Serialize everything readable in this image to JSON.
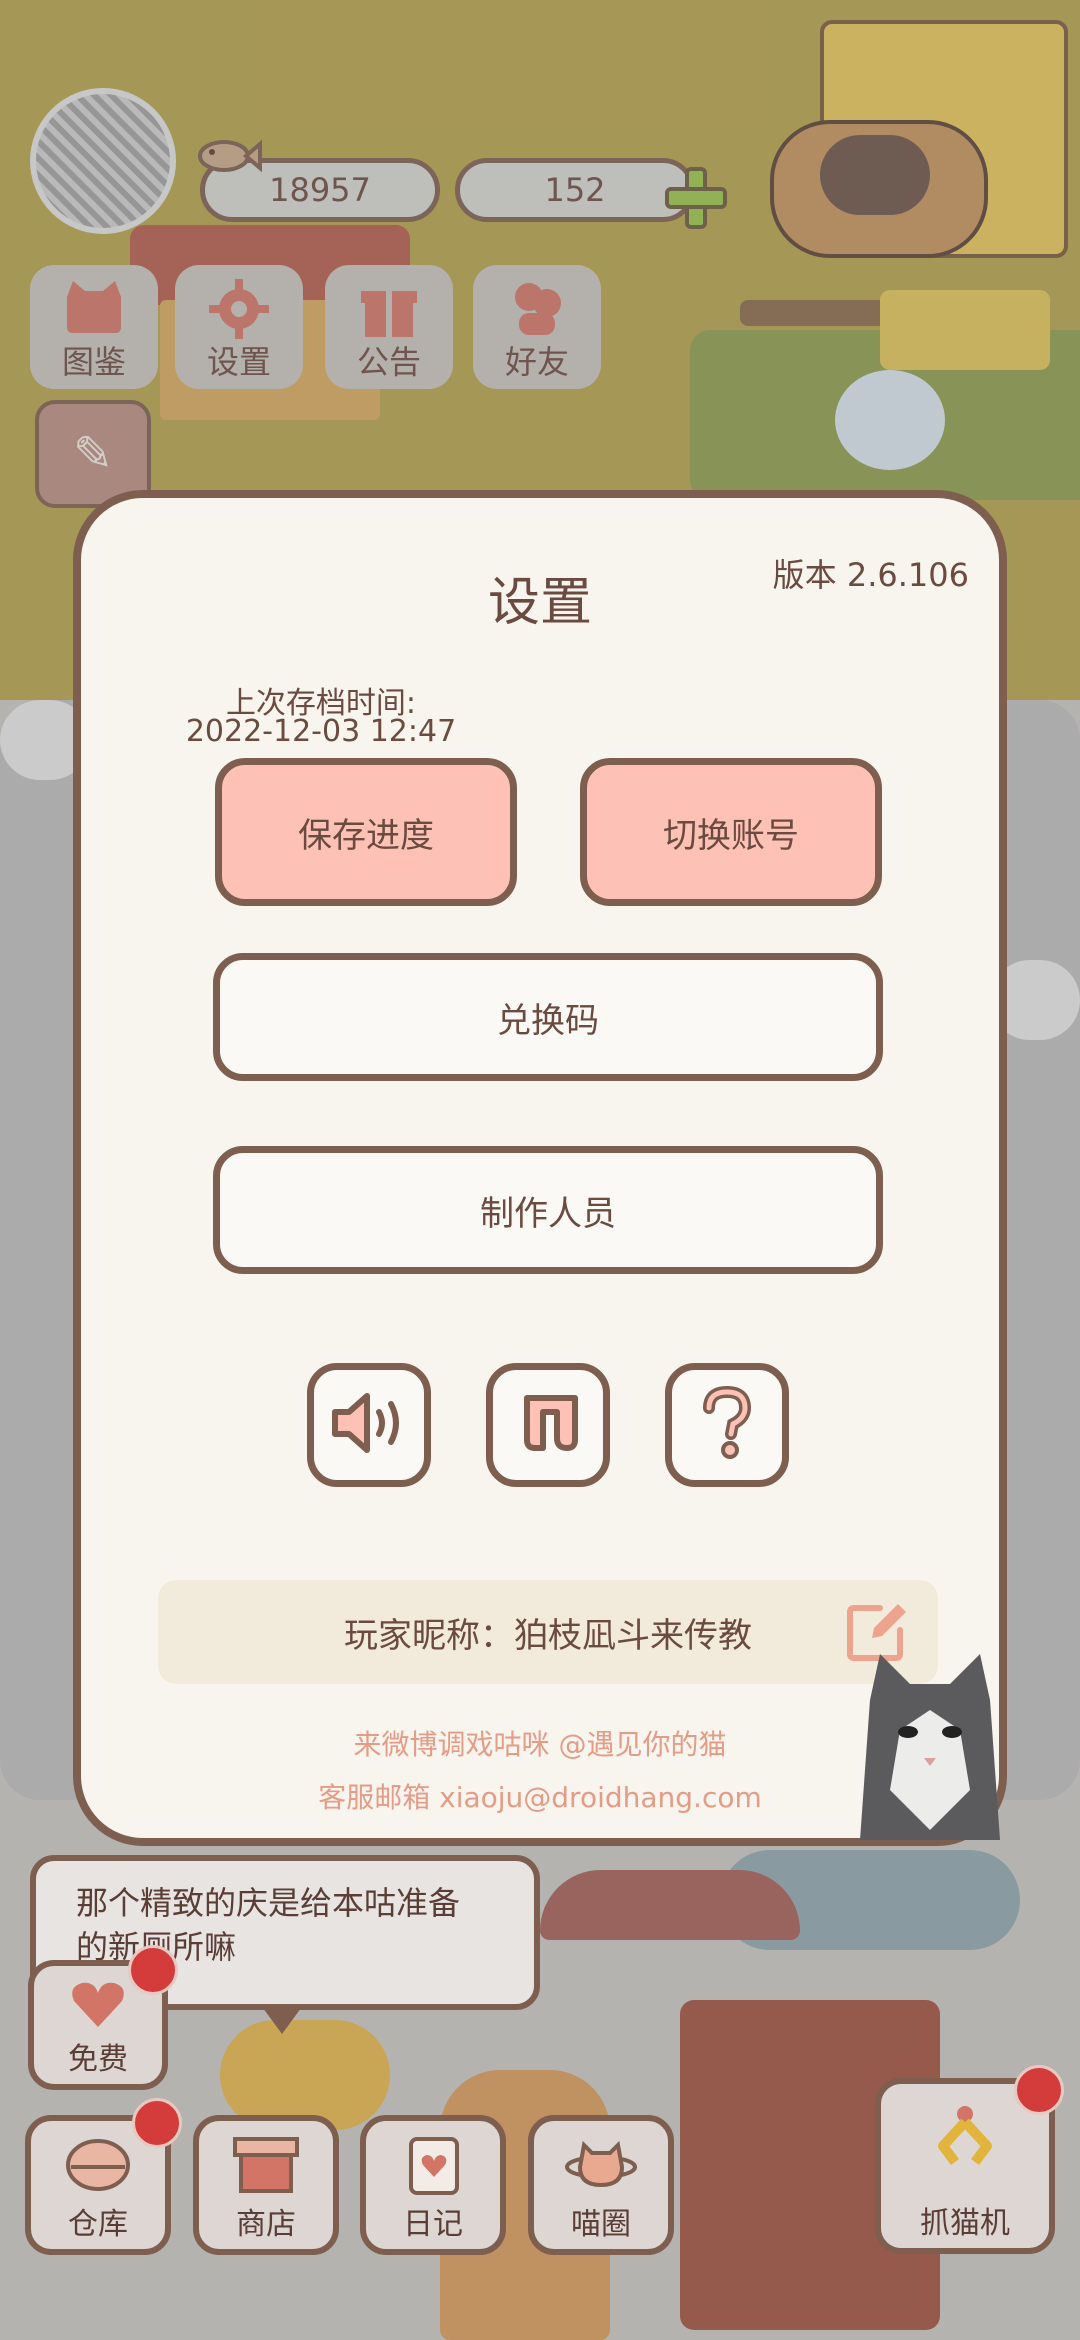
{
  "hud": {
    "fish_count": "18957",
    "heart_count": "152"
  },
  "menu": {
    "items": [
      {
        "label": "图鉴",
        "icon": "cat-book-icon"
      },
      {
        "label": "设置",
        "icon": "gear-icon"
      },
      {
        "label": "公告",
        "icon": "gift-icon"
      },
      {
        "label": "好友",
        "icon": "friends-icon"
      }
    ]
  },
  "dialog": {
    "title": "设置",
    "version": "版本 2.6.106",
    "save_time_label": "上次存档时间:",
    "save_time_value": "2022-12-03 12:47",
    "save_button": "保存进度",
    "switch_account_button": "切换账号",
    "redeem_code_button": "兑换码",
    "credits_button": "制作人员",
    "nickname_label": "玩家昵称：",
    "nickname_value": "狛枝凪斗来传教",
    "footer_weibo": "来微博调戏咕咪 @遇见你的猫",
    "footer_email": "客服邮箱 xiaoju@droidhang.com"
  },
  "speech": {
    "line1": "那个精致的庆是给本咕准备",
    "line2": "的新厕所嘛"
  },
  "bottom": {
    "free": "免费",
    "storage": "仓库",
    "shop": "商店",
    "diary": "日记",
    "circle": "喵圈",
    "claw": "抓猫机"
  },
  "colors": {
    "accent_pink": "#fdc2b5",
    "border_brown": "#7e5e4f",
    "footer_text": "#e59c86",
    "badge_red": "#d43c3c"
  }
}
